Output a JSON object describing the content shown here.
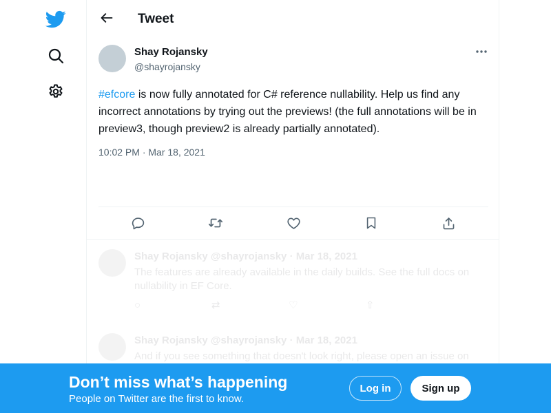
{
  "header": {
    "title": "Tweet"
  },
  "tweet": {
    "author_name": "Shay Rojansky",
    "author_handle": "@shayrojansky",
    "hashtag": "#efcore",
    "text": " is now fully annotated for C# reference nullability. Help us find any incorrect annotations by trying out the previews! (the full annotations will be in preview3, though preview2 is already partially annotated).",
    "timestamp": "10:02 PM · Mar 18, 2021"
  },
  "icons": {
    "logo": "twitter-bird-icon",
    "search": "search-icon",
    "settings": "gear-icon",
    "back": "arrow-left-icon",
    "more": "more-dots-icon",
    "reply": "reply-icon",
    "retweet": "retweet-icon",
    "like": "heart-icon",
    "bookmark": "bookmark-icon",
    "share": "share-icon"
  },
  "replies": [
    {
      "name": "Shay Rojansky @shayrojansky · Mar 18, 2021",
      "text": "The features are already available in the daily builds. See the full docs on nullability in EF Core."
    },
    {
      "name": "Shay Rojansky @shayrojansky · Mar 18, 2021",
      "text": "And if you see something that doesn't look right, please open an issue on the EF Core repo."
    }
  ],
  "bottom_bar": {
    "title": "Don’t miss what’s happening",
    "subtitle": "People on Twitter are the first to know.",
    "login_label": "Log in",
    "signup_label": "Sign up"
  },
  "colors": {
    "brand_blue": "#1d9bf0",
    "text_primary": "#0f1419",
    "text_secondary": "#536471",
    "border": "#eff3f4"
  }
}
